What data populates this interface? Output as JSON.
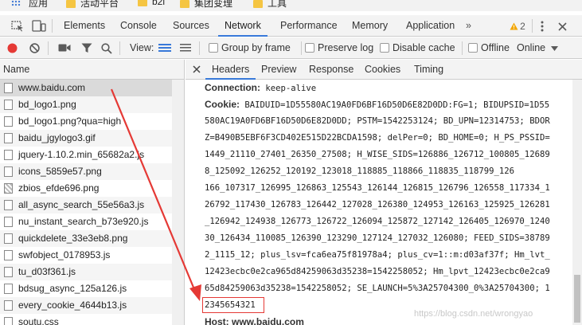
{
  "bookmarks": [
    "应用",
    "活动平台",
    "b2i",
    "集团变理",
    "工具"
  ],
  "devtools_tabs": [
    "Elements",
    "Console",
    "Sources",
    "Network",
    "Performance",
    "Memory",
    "Application"
  ],
  "active_tab": "Network",
  "warnings_count": "2",
  "toolbar": {
    "view_label": "View:",
    "group_by_frame": "Group by frame",
    "preserve_log": "Preserve log",
    "disable_cache": "Disable cache",
    "offline": "Offline",
    "online": "Online"
  },
  "requests": {
    "header": "Name",
    "items": [
      {
        "name": "www.baidu.com",
        "type": "doc"
      },
      {
        "name": "bd_logo1.png",
        "type": "doc"
      },
      {
        "name": "bd_logo1.png?qua=high",
        "type": "doc"
      },
      {
        "name": "baidu_jgylogo3.gif",
        "type": "doc"
      },
      {
        "name": "jquery-1.10.2.min_65682a2.js",
        "type": "doc"
      },
      {
        "name": "icons_5859e57.png",
        "type": "doc"
      },
      {
        "name": "zbios_efde696.png",
        "type": "img"
      },
      {
        "name": "all_async_search_55e56a3.js",
        "type": "doc"
      },
      {
        "name": "nu_instant_search_b73e920.js",
        "type": "doc"
      },
      {
        "name": "quickdelete_33e3eb8.png",
        "type": "doc"
      },
      {
        "name": "swfobject_0178953.js",
        "type": "doc"
      },
      {
        "name": "tu_d03f361.js",
        "type": "doc"
      },
      {
        "name": "bdsug_async_125a126.js",
        "type": "doc"
      },
      {
        "name": "every_cookie_4644b13.js",
        "type": "doc"
      },
      {
        "name": "soutu.css",
        "type": "doc"
      }
    ]
  },
  "detail_tabs": [
    "Headers",
    "Preview",
    "Response",
    "Cookies",
    "Timing"
  ],
  "active_detail_tab": "Headers",
  "headers": {
    "connection_key": "Connection:",
    "connection_value": "keep-alive",
    "cookie_key": "Cookie:",
    "cookie_lines": [
      "BAIDUID=1D55580AC19A0FD6BF16D50D6E82D0DD:FG=1; BIDUPSID=1D55",
      "580AC19A0FD6BF16D50D6E82D0DD; PSTM=1542253124; BD_UPN=12314753; BDOR",
      "Z=B490B5EBF6F3CD402E515D22BCDA1598; delPer=0; BD_HOME=0; H_PS_PSSID=",
      "1449_21110_27401_26350_27508; H_WISE_SIDS=126886_126712_100805_12689",
      "8_125092_126252_120192_123018_118885_118866_118835_118799_126",
      "166_107317_126995_126863_125543_126144_126815_126796_126558_117334_1",
      "26792_117430_126783_126442_127028_126380_124953_126163_125925_126281",
      "_126942_124938_126773_126722_126094_125872_127142_126405_126970_1240",
      "30_126434_110085_126390_123290_127124_127032_126080; FEED_SIDS=38789",
      "2_1115_12; plus_lsv=fca6ea75f81978a4; plus_cv=1::m:d03af37f; Hm_lvt_",
      "12423ecbc0e2ca965d84259063d35238=1542258052; Hm_lpvt_12423ecbc0e2ca9",
      "65d84259063d35238=1542258052; SE_LAUNCH=5%3A25704300_0%3A25704300; 1"
    ],
    "highlighted_value": "2345654321",
    "host_line": "Host: www.baidu.com"
  },
  "watermark": "https://blog.csdn.net/wrongyao",
  "colors": {
    "accent": "#3879d9",
    "record": "#e53935",
    "highlight_box": "#e53935",
    "arrow": "#e53935",
    "warning": "#f2a600"
  }
}
